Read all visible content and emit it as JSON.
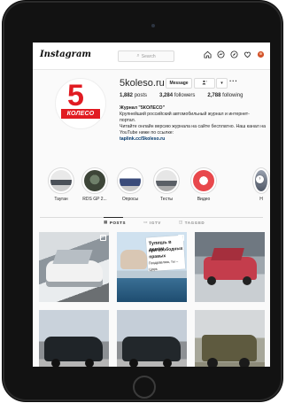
{
  "app": {
    "logo": "Instagram",
    "search_placeholder": "Search"
  },
  "profile": {
    "username": "5koleso.ru",
    "message_label": "Message",
    "logo_number": "5",
    "logo_text": "КОЛЕСО",
    "stats": {
      "posts": "1,882",
      "posts_label": "posts",
      "followers": "3,284",
      "followers_label": "followers",
      "following": "2,788",
      "following_label": "following"
    },
    "bio": {
      "name": "Журнал \"5КОЛЕСО\"",
      "line1": "Крупнейший российский автомобильный журнал и интернет-портал.",
      "line2": "Читайте онлайн версию журнала на сайте бесплатно. Наш канал на YouTube ниже по ссылке:",
      "link": "taplink.cc/5koleso.ru"
    }
  },
  "highlights": [
    {
      "label": "Тауган"
    },
    {
      "label": "RDS GP 2..."
    },
    {
      "label": "Опросы"
    },
    {
      "label": "Тесты"
    },
    {
      "label": "Видео"
    },
    {
      "label": "Н"
    }
  ],
  "tabs": [
    {
      "label": "POSTS"
    },
    {
      "label": "IGTV"
    },
    {
      "label": "TAGGED"
    }
  ],
  "posts": {
    "caption_line1": "Тупишь в левом",
    "caption_line2": "при свободных правых",
    "caption_line3": "Поздравляю, ты – Царь"
  },
  "colors": {
    "brand_red": "#e11b22",
    "link": "#00376b",
    "text": "#262626",
    "muted": "#8e8e8e",
    "border": "#dbdbdb"
  },
  "icons": [
    "search-icon",
    "home-icon",
    "messenger-icon",
    "explore-icon",
    "heart-icon",
    "avatar",
    "follow-person-icon",
    "chevron-down-icon",
    "more-icon",
    "grid-icon",
    "igtv-icon",
    "tagged-icon",
    "multiple-posts-icon"
  ]
}
